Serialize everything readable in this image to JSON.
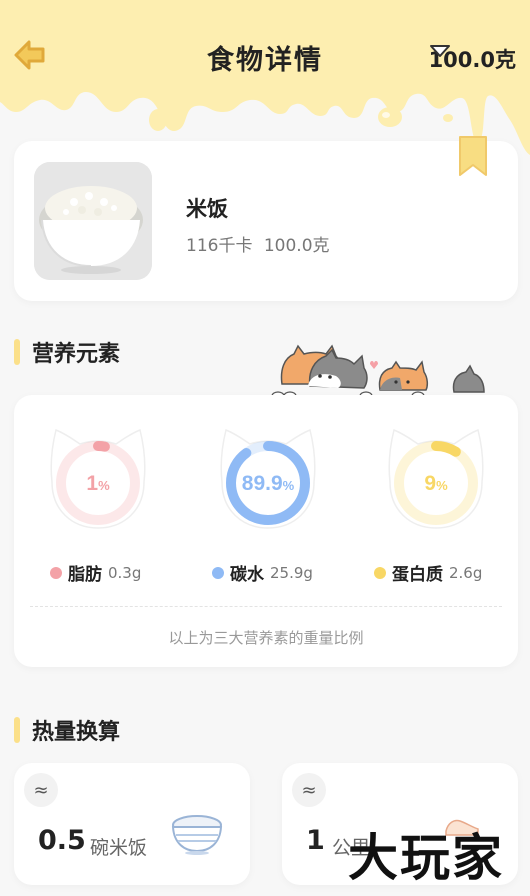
{
  "header": {
    "title": "食物详情",
    "weight_selector": "100.0克",
    "colors": {
      "drip": "#fdeeb0",
      "accent": "#f2c14e"
    }
  },
  "food": {
    "name": "米饭",
    "calories": "116千卡",
    "weight": "100.0克",
    "icons": [
      "rice-bowl-photo",
      "bookmark-icon"
    ]
  },
  "nutrition": {
    "title": "营养元素",
    "items": [
      {
        "percent_text": "1",
        "percent_value": 1,
        "unit": "%",
        "name": "脂肪",
        "amount": "0.3g",
        "color": "#f3a2a7"
      },
      {
        "percent_text": "89.9",
        "percent_value": 89.9,
        "unit": "%",
        "name": "碳水",
        "amount": "25.9g",
        "color": "#8fbaf5"
      },
      {
        "percent_text": "9",
        "percent_value": 9,
        "unit": "%",
        "name": "蛋白质",
        "amount": "2.6g",
        "color": "#f8d765"
      }
    ],
    "note": "以上为三大营养素的重量比例"
  },
  "conversion": {
    "title": "热量换算",
    "approx_symbol": "≈",
    "cards": [
      {
        "value": "0.5",
        "unit": "碗米饭"
      },
      {
        "value": "1",
        "unit": "公里"
      }
    ]
  },
  "watermark": "大玩家"
}
